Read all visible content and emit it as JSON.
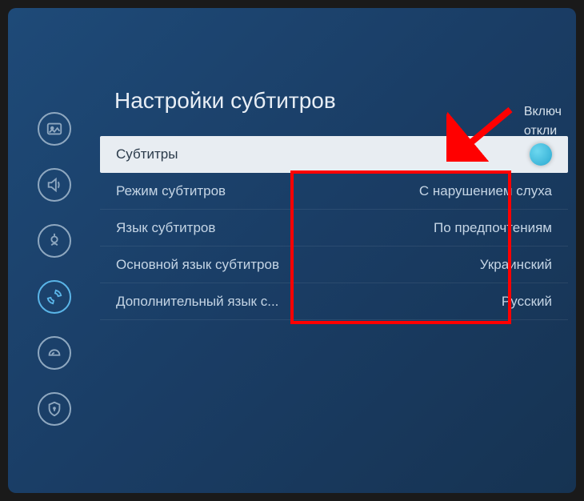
{
  "page_title": "Настройки субтитров",
  "right_panel": {
    "line1": "Включ",
    "line2": "откли"
  },
  "sidebar": {
    "items": [
      {
        "name": "picture-icon",
        "active": false
      },
      {
        "name": "sound-icon",
        "active": false
      },
      {
        "name": "broadcast-icon",
        "active": false
      },
      {
        "name": "general-icon",
        "active": true
      },
      {
        "name": "support-icon",
        "active": false
      },
      {
        "name": "privacy-icon",
        "active": false
      }
    ]
  },
  "toggle_row": {
    "label": "Субтитры",
    "state": "on"
  },
  "rows": [
    {
      "label": "Режим субтитров",
      "value": "С нарушением слуха"
    },
    {
      "label": "Язык субтитров",
      "value": "По предпочтениям"
    },
    {
      "label": "Основной язык субтитров",
      "value": "Украинский"
    },
    {
      "label": "Дополнительный язык с...",
      "value": "Русский"
    }
  ]
}
